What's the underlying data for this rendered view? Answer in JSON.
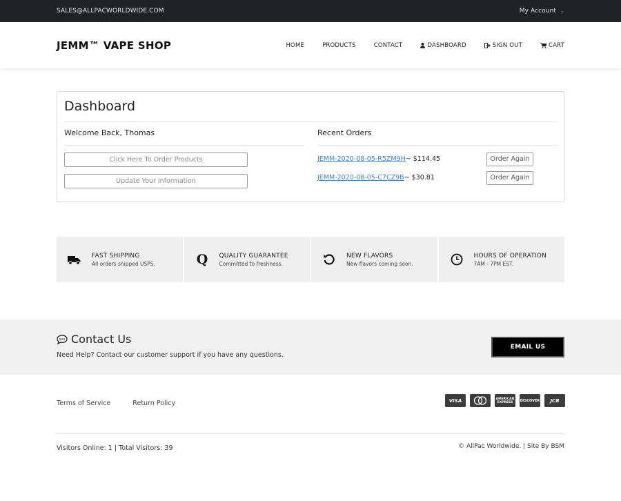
{
  "topbar": {
    "email": "SALES@ALLPACWORLDWIDE.COM",
    "account_label": "My Account",
    "account_chevron": "⌄"
  },
  "header": {
    "brand": "JEMM™ VAPE SHOP",
    "nav": [
      {
        "label": "HOME",
        "icon": ""
      },
      {
        "label": "PRODUCTS",
        "icon": ""
      },
      {
        "label": "CONTACT",
        "icon": ""
      },
      {
        "label": "DASHBOARD",
        "icon": "user-icon"
      },
      {
        "label": "SIGN OUT",
        "icon": "sign-out-icon"
      },
      {
        "label": "CART",
        "icon": "cart-icon"
      }
    ]
  },
  "dashboard": {
    "title": "Dashboard",
    "welcome": "Welcome Back, Thomas",
    "order_button": "Click Here To Order Products",
    "update_button": "Update Your Information",
    "recent_heading": "Recent Orders",
    "orders": [
      {
        "id": "JEMM-2020-08-05-R5ZM9H",
        "amount": " ~ $114.45",
        "action": "Order Again"
      },
      {
        "id": "JEMM-2020-08-05-C7CZ9B",
        "amount": " ~ $30.81",
        "action": "Order Again"
      }
    ]
  },
  "features": [
    {
      "icon": "truck-icon",
      "title": "FAST SHIPPING",
      "subtitle": "All orders shipped USPS."
    },
    {
      "icon": "q-icon",
      "title": "QUALITY GUARANTEE",
      "subtitle": "Committed to freshness."
    },
    {
      "icon": "refresh-icon",
      "title": "NEW FLAVORS",
      "subtitle": "New flavors coming soon."
    },
    {
      "icon": "clock-icon",
      "title": "HOURS OF OPERATION",
      "subtitle": "7AM - 7PM EST."
    }
  ],
  "contact": {
    "heading": "Contact Us",
    "text": "Need Help? Contact our customer support if you have any questions.",
    "button": "EMAIL US"
  },
  "footer": {
    "links": [
      "Terms of Service",
      "Return Policy"
    ],
    "cards": [
      "VISA",
      "MC",
      "AMEX",
      "DISCOVER",
      "JCB"
    ],
    "visitors": "Visitors Online: 1 | Total Visitors: 39",
    "copyright": "© AllPac Worldwide. | Site By BSM"
  }
}
